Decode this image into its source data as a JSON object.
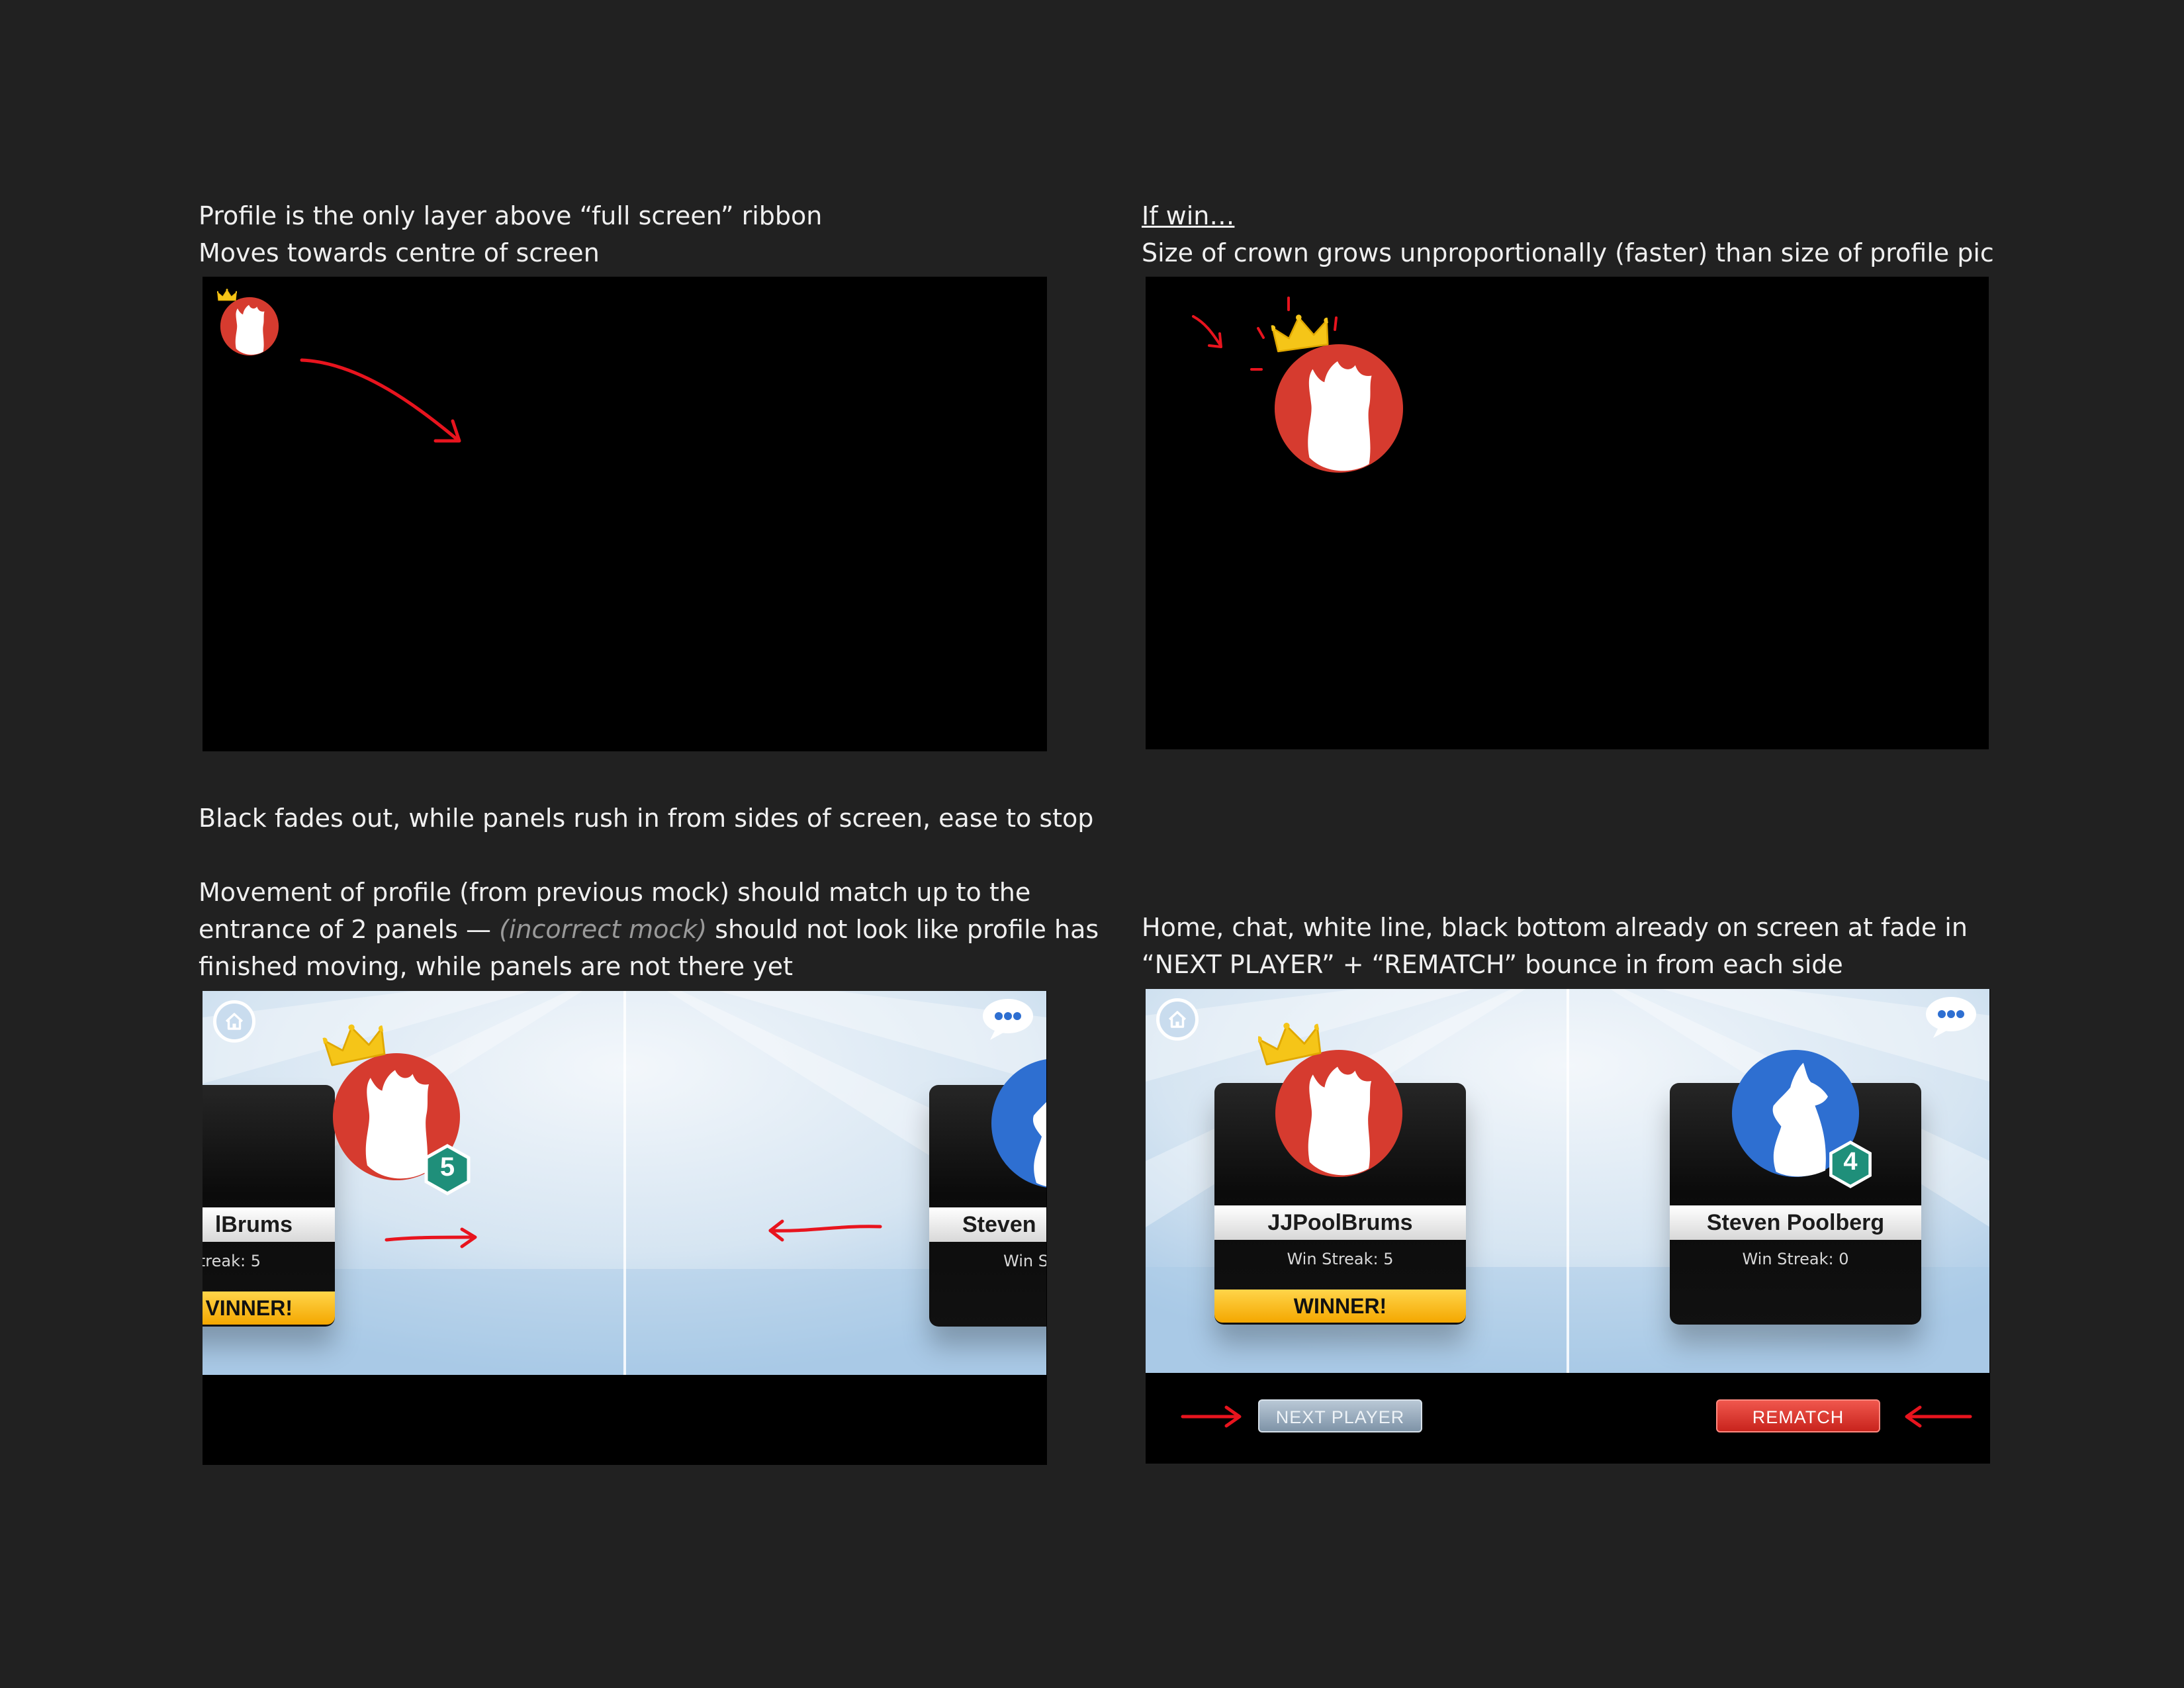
{
  "notes": {
    "top_left": [
      "Profile is the only layer above “full screen” ribbon",
      "Moves towards centre of screen"
    ],
    "top_right_heading": "If win…",
    "top_right_line": "Size of crown grows unproportionally (faster) than size of profile pic",
    "bottom_left_1": "Black fades out, while panels rush in from sides of screen, ease to stop",
    "bottom_left_2a": "Movement of profile (from previous mock) should match up to the",
    "bottom_left_2b_pre": "entrance of 2 panels — ",
    "bottom_left_2b_muted": "(incorrect mock)",
    "bottom_left_2b_post": " should not look like profile has",
    "bottom_left_2c": "finished moving, while panels are not there yet",
    "bottom_right": [
      "Home, chat, white line, black bottom already on screen at fade in",
      "“NEXT PLAYER” + “REMATCH” bounce in from each side"
    ]
  },
  "mock3": {
    "player1_name": "lBrums",
    "player1_streak": "treak: 5",
    "player1_badge": "VINNER!",
    "player1_level": "5",
    "player2_name": "Steven",
    "player2_streak": "Win S"
  },
  "mock4": {
    "player1": {
      "name": "JJPoolBrums",
      "streak": "Win Streak: 5",
      "badge": "WINNER!"
    },
    "player2": {
      "name": "Steven Poolberg",
      "streak": "Win Streak: 0",
      "level": "4"
    },
    "next_button": "NEXT PLAYER",
    "rematch_button": "REMATCH"
  },
  "icons": [
    "home-icon",
    "chat-icon",
    "crown-icon",
    "wolf-avatar",
    "level-badge-icon",
    "arrow-annotation"
  ],
  "colors": {
    "background": "#212121",
    "red_avatar": "#d63b2f",
    "blue_avatar": "#2e6fd1",
    "crown": "#f5c518",
    "annotation": "#e8141e",
    "winner_bar": "#f7c22e",
    "rematch": "#e0352c",
    "next_player": "#8fa3b6"
  }
}
